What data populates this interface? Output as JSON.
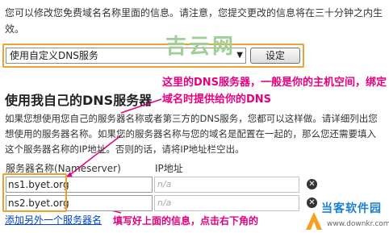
{
  "intro_text": "您可以修改您免费域名名称里面的信息。请注意，您提交更改的信息将在三十分钟之内生效。",
  "dns_select": {
    "value": "使用自定义DNS服务"
  },
  "set_button_label": "设定",
  "watermark_top": "吉云网",
  "section_title": "使用我自己的DNS服务器",
  "annotation_top": "这里的DNS服务器，一般是你的主机空间，绑定域名时提供给你的DNS",
  "description": "如果您想使用您自己的服务器名称或者第三方的DNS服务，您都可以这样做。请详细列出您想使用的服务器名称。如果您的服务器名称与您的域名是配置在一起的，那么您还需要填入这个服务器名称的IP地址。否则的话，请将IP地址栏空出。",
  "columns": {
    "nameserver": "服务器名称(Nameserver)",
    "ip": "IP地址"
  },
  "rows": [
    {
      "ns": "ns1.byet.org",
      "ip_placeholder": "n/a"
    },
    {
      "ns": "ns2.byet.org",
      "ip_placeholder": "n/a"
    }
  ],
  "add_link": "添加另外一个服务器名",
  "annotation_bottom": "填写好上面的信息，点击右下角的",
  "logo": {
    "name": "当客软件园",
    "url": "www.downkr.com"
  },
  "colors": {
    "highlight": "#f0a12c",
    "annotation": "#e6007e",
    "link": "#0044cc"
  }
}
